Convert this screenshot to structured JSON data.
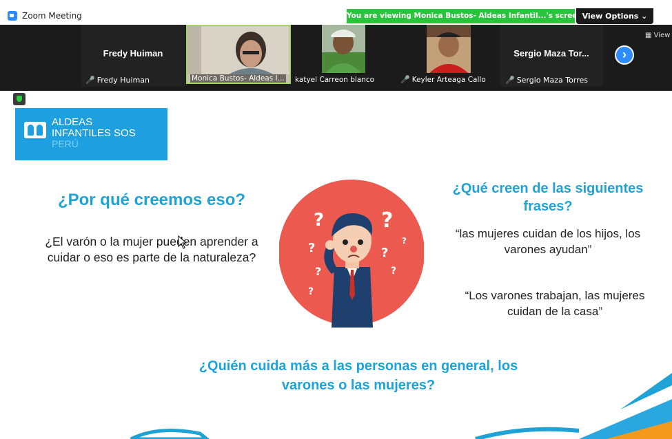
{
  "window": {
    "title": "Zoom Meeting"
  },
  "share_banner": "You are viewing Monica Bustos- Aldeas Infantil...'s screen",
  "view_options": {
    "label": "View Options",
    "chevron": "⌄"
  },
  "strip_view": "View",
  "participants": [
    {
      "tile_name": "Fredy Huiman",
      "caption": "Fredy Huiman",
      "muted": true
    },
    {
      "caption": "Monica Bustos- Aldeas I...",
      "muted": false,
      "active": true
    },
    {
      "caption": "katyel Carreon blanco",
      "muted": false
    },
    {
      "caption": "Keyler Arteaga Callo",
      "muted": true
    },
    {
      "tile_name": "Sergio Maza Tor...",
      "caption": "Sergio Maza Torres",
      "muted": true
    }
  ],
  "icons": {
    "mute": "muted-mic-icon",
    "next": "chevron-right-icon",
    "shield": "security-shield-icon"
  },
  "slide": {
    "logo": {
      "line1": "ALDEAS",
      "line2": "INFANTILES SOS",
      "line3": "PERÚ"
    },
    "left_question": "¿Por qué creemos eso?",
    "left_text": "¿El varón o la mujer pueden aprender a cuidar  o eso es parte de la naturaleza?",
    "right_question": "¿Qué creen de las siguientes frases?",
    "quote1": "“las mujeres cuidan de los hijos, los varones ayudan”",
    "quote2": "“Los varones trabajan, las mujeres cuidan de la casa”",
    "bottom_question": "¿Quién cuida más a las personas en general, los varones o las mujeres?"
  },
  "colors": {
    "accent_blue": "#1fa3d6",
    "banner_green": "#28c43c",
    "zoom_blue": "#2d8cff",
    "circle_red": "#ec5a4f"
  }
}
